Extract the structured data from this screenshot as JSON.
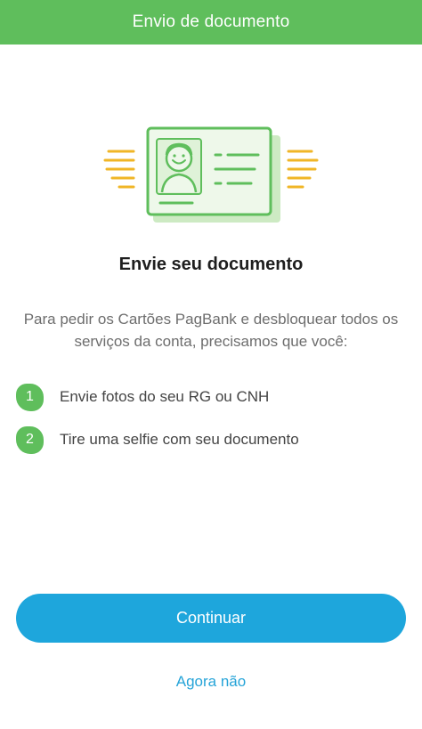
{
  "header": {
    "title": "Envio de documento"
  },
  "illustration": {
    "icon": "id-card-icon",
    "colors": {
      "card_stroke": "#5fbe5c",
      "card_fill": "#e6f4df",
      "card_shadow": "#cdeac3",
      "speed_lines": "#f0b627"
    }
  },
  "main": {
    "headline": "Envie seu documento",
    "intro": "Para pedir os Cartões PagBank e desbloquear todos os serviços da conta, precisamos que você:",
    "steps": [
      {
        "number": "1",
        "text": "Envie fotos do seu RG ou CNH"
      },
      {
        "number": "2",
        "text": "Tire uma selfie com seu documento"
      }
    ]
  },
  "actions": {
    "continue_label": "Continuar",
    "skip_label": "Agora não"
  },
  "colors": {
    "brand_green": "#5fbe5c",
    "primary_blue": "#1ea6dc",
    "link_blue": "#26a4d8"
  }
}
